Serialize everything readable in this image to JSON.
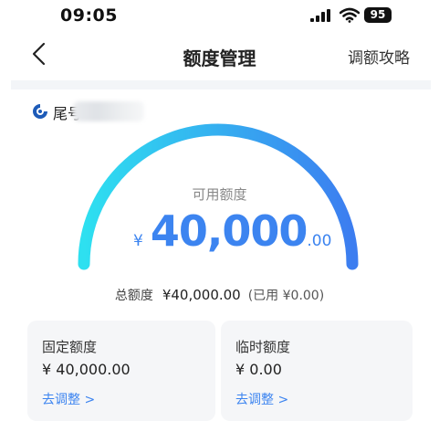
{
  "status_bar": {
    "time": "09:05",
    "battery": "95"
  },
  "nav": {
    "title": "额度管理",
    "guide_label": "调额攻略"
  },
  "account": {
    "name_prefix": "尾号"
  },
  "credit": {
    "available_label": "可用额度",
    "currency": "¥",
    "available_integer": "40,000",
    "available_decimal": ".00",
    "total_label": "总额度",
    "total_value": "¥40,000.00",
    "used_text": "(已用 ¥0.00)",
    "available_fraction": 1.0
  },
  "cards": [
    {
      "title": "固定额度",
      "value": "¥ 40,000.00",
      "action": "去调整 >"
    },
    {
      "title": "临时额度",
      "value": "¥ 0.00",
      "action": "去调整 >"
    }
  ],
  "colors": {
    "accent": "#3c84f0",
    "gauge_start": "#2ee0f0",
    "gauge_end": "#3c7df0"
  }
}
